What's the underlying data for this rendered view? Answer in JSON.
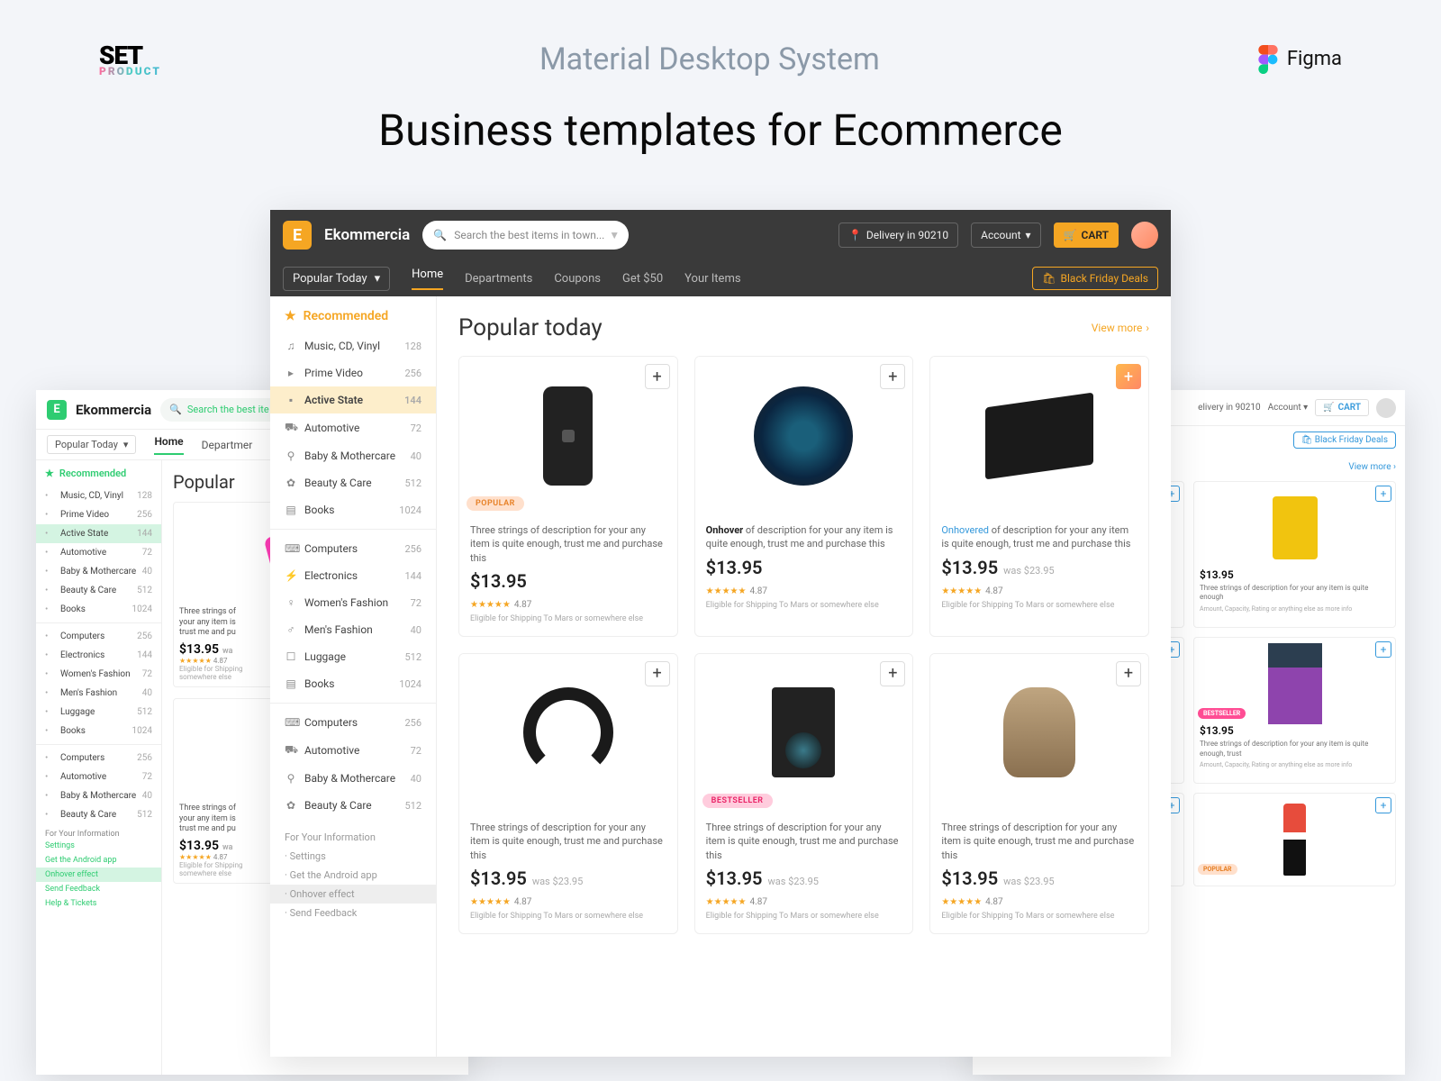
{
  "header": {
    "logo_top": "SET",
    "logo_bottom": "PRODUCT",
    "subtitle": "Material Desktop System",
    "figma_label": "Figma",
    "title": "Business templates for Ecommerce"
  },
  "common": {
    "brand": "Ekommercia",
    "search_placeholder": "Search the best items in town...",
    "search_placeholder_short": "Search the best ite",
    "delivery": "Delivery in 90210",
    "account": "Account",
    "cart": "CART",
    "black_friday": "Black Friday Deals",
    "popular_selector": "Popular Today",
    "tabs": [
      "Home",
      "Departments",
      "Coupons",
      "Get $50",
      "Your Items"
    ],
    "recommended": "Recommended",
    "section_title": "Popular today",
    "view_more": "View more",
    "for_your_info": "For Your Information",
    "footer_links": [
      "Settings",
      "Get the Android app",
      "Onhover effect",
      "Send Feedback",
      "Help & Tickets"
    ]
  },
  "categories_full": [
    {
      "name": "Music, CD, Vinyl",
      "count": 128,
      "icon": "♫"
    },
    {
      "name": "Prime Video",
      "count": 256,
      "icon": "▸"
    },
    {
      "name": "Active State",
      "count": 144,
      "icon": "▪",
      "active": true
    },
    {
      "name": "Automotive",
      "count": 72,
      "icon": "⛟"
    },
    {
      "name": "Baby & Mothercare",
      "count": 40,
      "icon": "⚲"
    },
    {
      "name": "Beauty & Care",
      "count": 512,
      "icon": "✿"
    },
    {
      "name": "Books",
      "count": 1024,
      "icon": "▤"
    },
    {
      "name": "Computers",
      "count": 256,
      "icon": "⌨"
    },
    {
      "name": "Electronics",
      "count": 144,
      "icon": "⚡"
    },
    {
      "name": "Women's Fashion",
      "count": 72,
      "icon": "♀"
    },
    {
      "name": "Men's Fashion",
      "count": 40,
      "icon": "♂"
    },
    {
      "name": "Luggage",
      "count": 512,
      "icon": "☐"
    },
    {
      "name": "Books",
      "count": 1024,
      "icon": "▤"
    },
    {
      "name": "Computers",
      "count": 256,
      "icon": "⌨"
    },
    {
      "name": "Automotive",
      "count": 72,
      "icon": "⛟"
    },
    {
      "name": "Baby & Mothercare",
      "count": 40,
      "icon": "⚲"
    },
    {
      "name": "Beauty & Care",
      "count": 512,
      "icon": "✿"
    }
  ],
  "categories_green": [
    {
      "name": "Music, CD, Vinyl",
      "count": 128
    },
    {
      "name": "Prime Video",
      "count": 256
    },
    {
      "name": "Active State",
      "count": 144,
      "active": true
    },
    {
      "name": "Automotive",
      "count": 72
    },
    {
      "name": "Baby & Mothercare",
      "count": 40
    },
    {
      "name": "Beauty & Care",
      "count": 512
    },
    {
      "name": "Books",
      "count": 1024
    },
    {
      "name": "Computers",
      "count": 256
    },
    {
      "name": "Electronics",
      "count": 144
    },
    {
      "name": "Women's Fashion",
      "count": 72
    },
    {
      "name": "Men's Fashion",
      "count": 40
    },
    {
      "name": "Luggage",
      "count": 512
    },
    {
      "name": "Books",
      "count": 1024
    },
    {
      "name": "Computers",
      "count": 256
    },
    {
      "name": "Automotive",
      "count": 72
    },
    {
      "name": "Baby & Mothercare",
      "count": 40
    },
    {
      "name": "Beauty & Care",
      "count": 512
    }
  ],
  "product_text": {
    "desc_line": "Three strings of description for your any item is quite enough, trust me and purchase this",
    "desc_onhover": "Onhover",
    "desc_onhover_rest": " of description for your any item is quite enough, trust me and purchase this",
    "desc_onhovered": "Onhovered",
    "desc_onhovered_rest": " of description for your any item is quite enough, trust me and purchase this",
    "desc_short": "Three strings of description for your any item is quite enough",
    "desc_blue_more": "Amount, Capacity, Rating or anything else as more info",
    "price": "$13.95",
    "was_price": "was $23.95",
    "rating_num": "4.87",
    "shipping": "Eligible for Shipping To Mars or somewhere else",
    "badge_popular": "POPULAR",
    "badge_bestseller": "BESTSELLER"
  }
}
